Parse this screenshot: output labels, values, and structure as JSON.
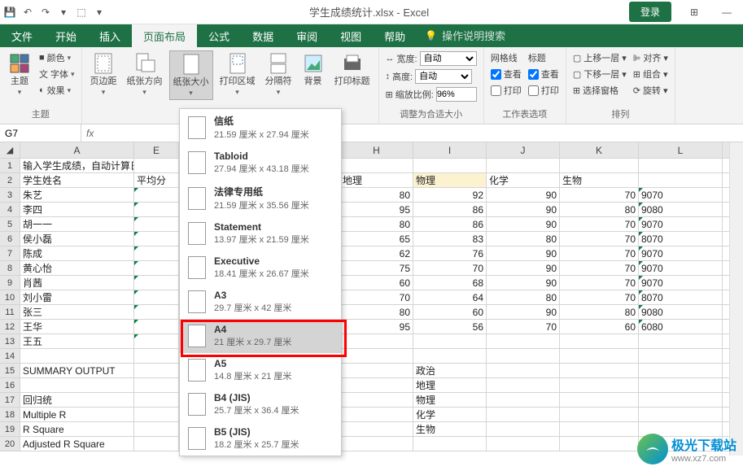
{
  "title": "学生成绩统计.xlsx - Excel",
  "login_btn": "登录",
  "tabs": [
    "文件",
    "开始",
    "插入",
    "页面布局",
    "公式",
    "数据",
    "审阅",
    "视图",
    "帮助"
  ],
  "tell_me": "操作说明搜索",
  "ribbon": {
    "theme": {
      "label": "主题",
      "main": "主题",
      "colors": "颜色",
      "fonts": "字体",
      "effects": "效果"
    },
    "page_setup": {
      "label": "",
      "margins": "页边距",
      "orientation": "纸张方向",
      "size": "纸张大小",
      "print_area": "打印区域",
      "breaks": "分隔符",
      "background": "背景",
      "print_titles": "打印标题"
    },
    "scale": {
      "label": "调整为合适大小",
      "width": "宽度:",
      "height": "高度:",
      "scale_lbl": "缩放比例:",
      "auto": "自动",
      "scale_val": "96%"
    },
    "sheet_opts": {
      "label": "工作表选项",
      "gridlines": "网格线",
      "headings": "标题",
      "view": "查看",
      "print": "打印"
    },
    "arrange": {
      "label": "排列",
      "forward": "上移一层",
      "backward": "下移一层",
      "selection": "选择窗格",
      "align": "对齐",
      "group": "组合",
      "rotate": "旋转"
    }
  },
  "name_box": "G7",
  "columns": [
    "A",
    "E",
    "H",
    "I",
    "J",
    "K",
    "L"
  ],
  "rows": [
    {
      "n": "1",
      "A": "输入学生成绩，自动计算日期：X"
    },
    {
      "n": "2",
      "A": "学生姓名",
      "E": "平均分",
      "H": "地理",
      "I": "物理",
      "J": "化学",
      "K": "生物",
      "L": ""
    },
    {
      "n": "3",
      "A": "朱艺",
      "H": "80",
      "I": "92",
      "J": "90",
      "K": "70",
      "L": "9070"
    },
    {
      "n": "4",
      "A": "李四",
      "H": "95",
      "I": "86",
      "J": "90",
      "K": "80",
      "L": "9080"
    },
    {
      "n": "5",
      "A": "胡一一",
      "H": "80",
      "I": "86",
      "J": "90",
      "K": "70",
      "L": "9070"
    },
    {
      "n": "6",
      "A": "侯小磊",
      "H": "65",
      "I": "83",
      "J": "80",
      "K": "70",
      "L": "8070"
    },
    {
      "n": "7",
      "A": "陈成",
      "H": "62",
      "I": "76",
      "J": "90",
      "K": "70",
      "L": "9070"
    },
    {
      "n": "8",
      "A": "黄心怡",
      "H": "75",
      "I": "70",
      "J": "90",
      "K": "70",
      "L": "9070"
    },
    {
      "n": "9",
      "A": "肖茜",
      "H": "60",
      "I": "68",
      "J": "90",
      "K": "70",
      "L": "9070"
    },
    {
      "n": "10",
      "A": "刘小雷",
      "H": "70",
      "I": "64",
      "J": "80",
      "K": "70",
      "L": "8070"
    },
    {
      "n": "11",
      "A": "张三",
      "H": "80",
      "I": "60",
      "J": "90",
      "K": "80",
      "L": "9080"
    },
    {
      "n": "12",
      "A": "王华",
      "H": "95",
      "I": "56",
      "J": "70",
      "K": "60",
      "L": "6080"
    },
    {
      "n": "13",
      "A": "王五"
    },
    {
      "n": "14"
    },
    {
      "n": "15",
      "A": "SUMMARY OUTPUT",
      "I": "政治"
    },
    {
      "n": "16",
      "I": "地理"
    },
    {
      "n": "17",
      "A": "回归统",
      "I": "物理"
    },
    {
      "n": "18",
      "A": "Multiple R",
      "I": "化学"
    },
    {
      "n": "19",
      "A": "R Square",
      "I": "生物"
    },
    {
      "n": "20",
      "A": "Adjusted R Square"
    }
  ],
  "paper_sizes": [
    {
      "name": "信纸",
      "dim": "21.59 厘米 x 27.94 厘米"
    },
    {
      "name": "Tabloid",
      "dim": "27.94 厘米 x 43.18 厘米"
    },
    {
      "name": "法律专用纸",
      "dim": "21.59 厘米 x 35.56 厘米"
    },
    {
      "name": "Statement",
      "dim": "13.97 厘米 x 21.59 厘米"
    },
    {
      "name": "Executive",
      "dim": "18.41 厘米 x 26.67 厘米"
    },
    {
      "name": "A3",
      "dim": "29.7 厘米 x 42 厘米"
    },
    {
      "name": "A4",
      "dim": "21 厘米 x 29.7 厘米"
    },
    {
      "name": "A5",
      "dim": "14.8 厘米 x 21 厘米"
    },
    {
      "name": "B4 (JIS)",
      "dim": "25.7 厘米 x 36.4 厘米"
    },
    {
      "name": "B5 (JIS)",
      "dim": "18.2 厘米 x 25.7 厘米"
    }
  ],
  "watermark": {
    "brand": "极光下载站",
    "url": "www.xz7.com"
  }
}
